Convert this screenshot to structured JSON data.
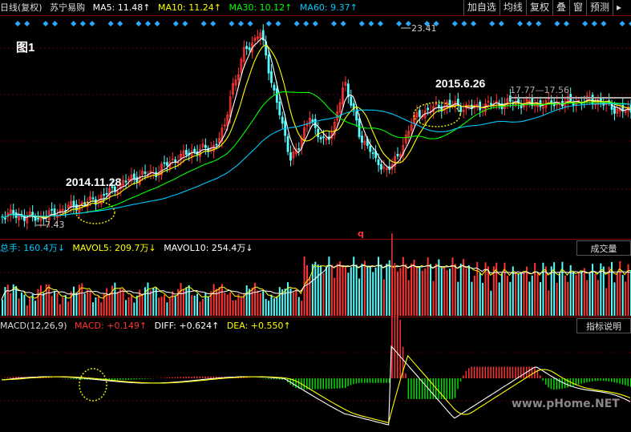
{
  "header": {
    "period": "日线(复权)",
    "stock": "苏宁易购",
    "ma5": "MA5: 11.48↑",
    "ma10": "MA10: 11.24↑",
    "ma30": "MA30: 10.12↑",
    "ma60": "MA60: 9.37↑",
    "buttons": [
      "加自选",
      "均线",
      "复权",
      "叠",
      "窗",
      "预测"
    ]
  },
  "colors": {
    "ma5": "#ffffff",
    "ma10": "#ffff00",
    "ma30": "#00ff00",
    "ma60": "#00c8ff",
    "up": "#ff3333",
    "down": "#54ffff"
  },
  "annotations": {
    "fig": "图1",
    "date1": "2014.11.28",
    "date2": "2015.6.26",
    "high": "23.41",
    "low": "7.43",
    "range": "17.77—17.56",
    "marker": "q"
  },
  "volume": {
    "total": "总手: 160.4万↓",
    "mavol5": "MAVOL5: 209.7万↓",
    "mavol10": "MAVOL10: 254.4万↓",
    "button": "成交量"
  },
  "macd": {
    "title": "MACD(12,26,9)",
    "macd": "MACD: +0.149↑",
    "diff": "DIFF: +0.624↑",
    "dea": "DEA: +0.550↑",
    "button": "指标说明"
  },
  "watermark": "www.pHome.NET",
  "chart_data": {
    "type": "line",
    "title": "",
    "xlabel": "",
    "ylabel": "",
    "price_range": [
      7.43,
      23.41
    ],
    "key_points": [
      {
        "label": "2014.11.28",
        "value": 7.43
      },
      {
        "label": "2015.6.26",
        "value": 17.77
      }
    ],
    "series": [
      {
        "name": "MA5",
        "last": 11.48
      },
      {
        "name": "MA10",
        "last": 11.24
      },
      {
        "name": "MA30",
        "last": 10.12
      },
      {
        "name": "MA60",
        "last": 9.37
      }
    ]
  }
}
